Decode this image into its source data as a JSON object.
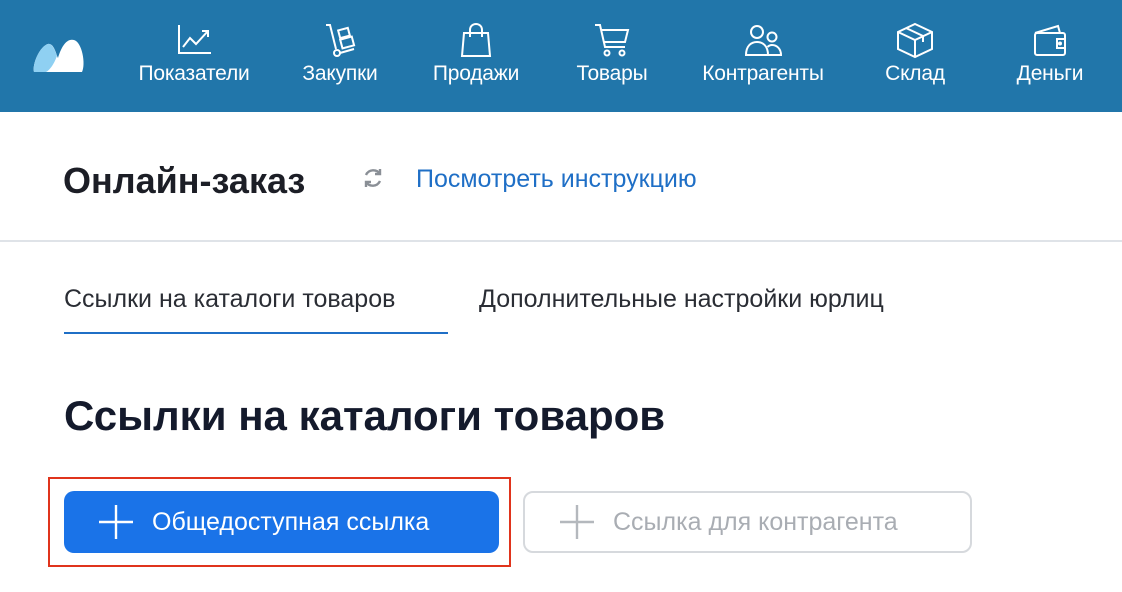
{
  "nav": {
    "items": [
      {
        "label": "Показатели",
        "icon": "chart-icon"
      },
      {
        "label": "Закупки",
        "icon": "hand-truck-icon"
      },
      {
        "label": "Продажи",
        "icon": "shopping-bag-icon"
      },
      {
        "label": "Товары",
        "icon": "cart-icon"
      },
      {
        "label": "Контрагенты",
        "icon": "people-icon"
      },
      {
        "label": "Склад",
        "icon": "box-icon"
      },
      {
        "label": "Деньги",
        "icon": "wallet-icon"
      }
    ]
  },
  "header": {
    "title": "Онлайн-заказ",
    "instruction_link": "Посмотреть инструкцию"
  },
  "tabs": [
    {
      "label": "Ссылки на каталоги товаров",
      "active": true
    },
    {
      "label": "Дополнительные настройки юрлиц",
      "active": false
    }
  ],
  "section": {
    "title": "Ссылки на каталоги товаров"
  },
  "buttons": {
    "public_link": "Общедоступная ссылка",
    "counterparty_link": "Ссылка для контрагента"
  },
  "colors": {
    "topbar": "#2176aa",
    "accent": "#1a73e8",
    "highlight": "#e0341c"
  }
}
